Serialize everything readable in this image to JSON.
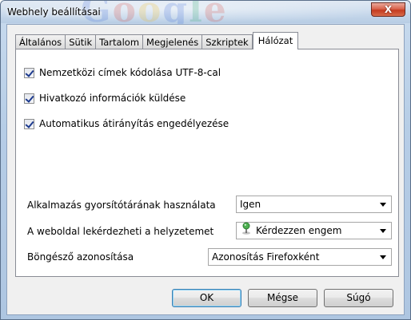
{
  "window": {
    "title": "Webhely beállításai",
    "close_label": "X",
    "background_logo_letters": [
      "G",
      "o",
      "o",
      "g",
      "l",
      "e"
    ]
  },
  "tabs": [
    {
      "label": "Általános",
      "active": false
    },
    {
      "label": "Sütik",
      "active": false
    },
    {
      "label": "Tartalom",
      "active": false
    },
    {
      "label": "Megjelenés",
      "active": false
    },
    {
      "label": "Szkriptek",
      "active": false
    },
    {
      "label": "Hálózat",
      "active": true
    }
  ],
  "checkboxes": [
    {
      "label": "Nemzetközi címek kódolása UTF-8-cal",
      "checked": true
    },
    {
      "label": "Hivatkozó információk küldése",
      "checked": true
    },
    {
      "label": "Automatikus átirányítás engedélyezése",
      "checked": true
    }
  ],
  "fields": [
    {
      "label": "Alkalmazás gyorsítótárának használata",
      "value": "Igen"
    },
    {
      "label": "A weboldal lekérdezheti a helyzetemet",
      "value": "Kérdezzen engem",
      "icon": "location-pin-icon"
    },
    {
      "label": "Böngésző azonosítása",
      "value": "Azonosítás Firefoxként"
    }
  ],
  "buttons": {
    "ok": "OK",
    "cancel": "Mégse",
    "help": "Súgó"
  }
}
